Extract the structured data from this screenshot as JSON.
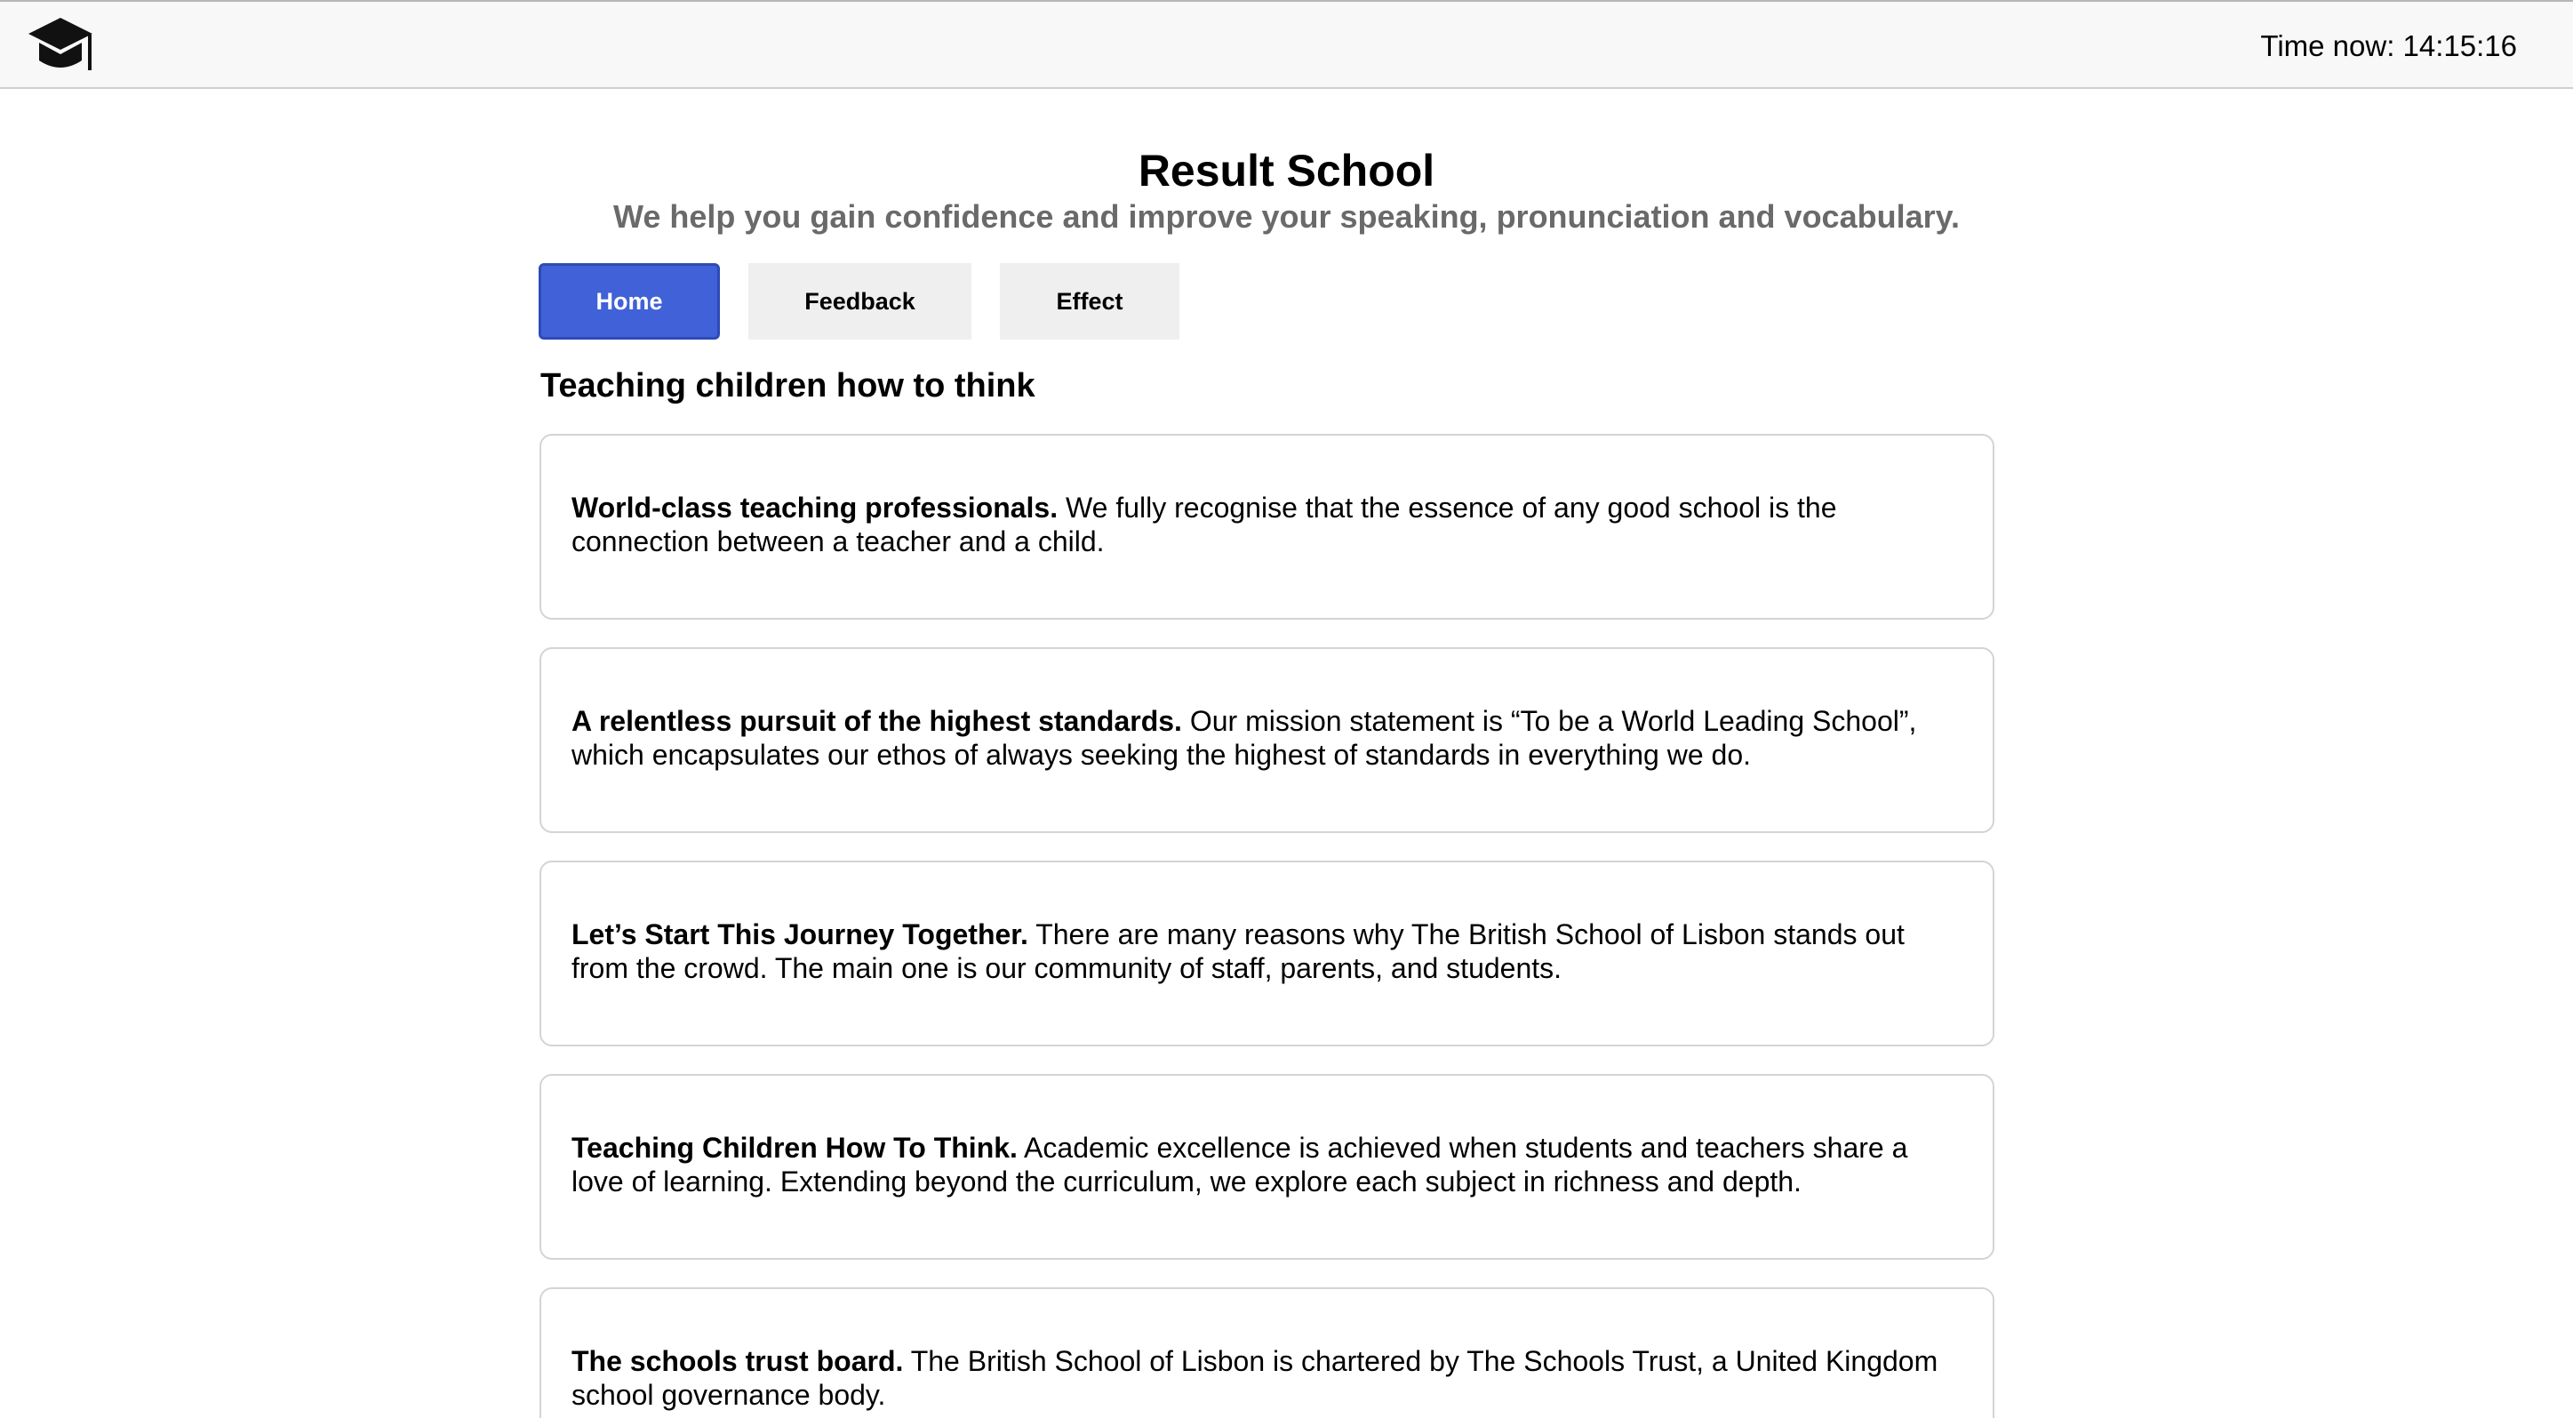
{
  "header": {
    "logo_icon": "graduation-cap-icon",
    "clock_text": "Time now: 14:15:16"
  },
  "hero": {
    "title": "Result School",
    "subtitle": "We help you gain confidence and improve your speaking, pronunciation and vocabulary."
  },
  "nav": {
    "tabs": [
      {
        "label": "Home",
        "active": true
      },
      {
        "label": "Feedback",
        "active": false
      },
      {
        "label": "Effect",
        "active": false
      }
    ],
    "active_color": "#4061d8"
  },
  "section": {
    "title": "Teaching children how to think"
  },
  "cards": [
    {
      "heading": "World-class teaching professionals.",
      "text": " We fully recognise that the essence of any good school is the connection between a teacher and a child."
    },
    {
      "heading": "A relentless pursuit of the highest standards.",
      "text": " Our mission statement is “To be a World Leading School”, which encapsulates our ethos of always seeking the highest of standards in everything we do."
    },
    {
      "heading": "Let’s Start This Journey Together.",
      "text": " There are many reasons why The British School of Lisbon stands out from the crowd. The main one is our community of staff, parents, and students."
    },
    {
      "heading": "Teaching Children How To Think.",
      "text": " Academic excellence is achieved when students and teachers share a love of learning. Extending beyond the curriculum, we explore each subject in richness and depth."
    },
    {
      "heading": "The schools trust board.",
      "text": " The British School of Lisbon is chartered by The Schools Trust, a United Kingdom school governance body."
    }
  ]
}
